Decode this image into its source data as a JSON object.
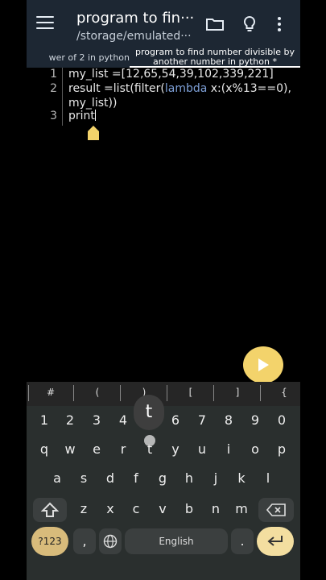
{
  "app_bar": {
    "title": "program to fin···",
    "path": "/storage/emulated···"
  },
  "tabs": {
    "inactive": "wer of 2 in python",
    "active_line1": "program to find number divisible by",
    "active_line2": "another number in python *"
  },
  "editor": {
    "lines": [
      {
        "num": "1",
        "text": "my_list =[12,65,54,39,102,339,221]"
      },
      {
        "num": "2",
        "pre": "result =list(filter(",
        "kw": "lambda",
        "post": " x:(x%13==0),"
      },
      {
        "num": "",
        "text": "my_list))"
      },
      {
        "num": "3",
        "text": "print"
      }
    ]
  },
  "symbols": [
    "#",
    "(",
    ")",
    "[",
    "]",
    "{"
  ],
  "keyboard": {
    "numbers": [
      "1",
      "2",
      "3",
      "4",
      "5",
      "6",
      "7",
      "8",
      "9",
      "0"
    ],
    "row1": [
      "q",
      "w",
      "e",
      "r",
      "t",
      "y",
      "u",
      "i",
      "o",
      "p"
    ],
    "row2": [
      "a",
      "s",
      "d",
      "f",
      "g",
      "h",
      "j",
      "k",
      "l"
    ],
    "row3": [
      "z",
      "x",
      "c",
      "v",
      "b",
      "n",
      "m"
    ],
    "sym_key": "?123",
    "comma": ",",
    "period": ".",
    "space_label": "English",
    "popup_letter": "t"
  },
  "colors": {
    "app_bar_bg": "#1d2733",
    "keyword": "#7d9fd6",
    "run_button": "#f3d36b",
    "keyboard_bg": "#2a2f2e"
  }
}
